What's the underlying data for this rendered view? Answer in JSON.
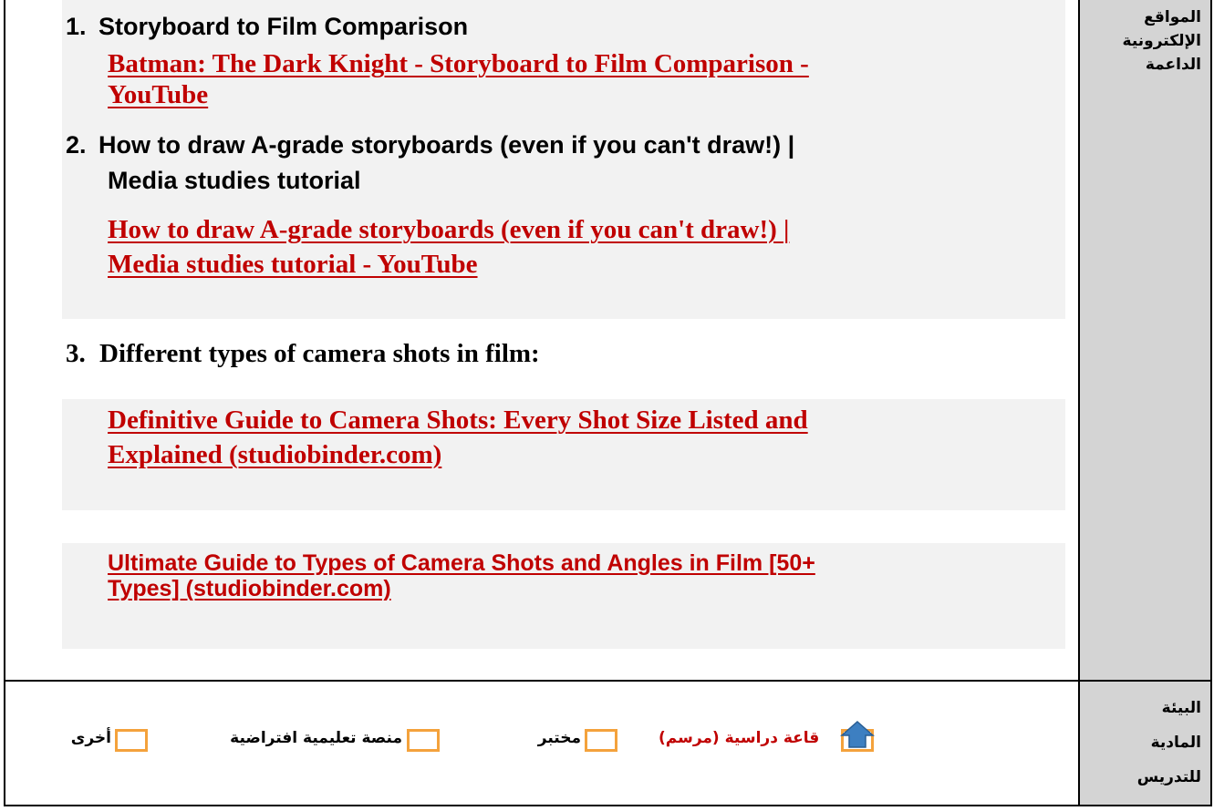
{
  "websites_section": {
    "label_line1": "المواقع",
    "label_line2": "الإلكترونية",
    "label_line3": "الداعمة",
    "items": [
      {
        "number": "1.",
        "title": "Storyboard to Film Comparison",
        "link_line1": "Batman: The Dark Knight - Storyboard to Film Comparison -",
        "link_line2": "YouTube"
      },
      {
        "number": "2.",
        "title_line1": "How to draw A-grade storyboards (even if you can't draw!) |",
        "title_line2": "Media studies tutorial",
        "link_line1": "How to draw A-grade storyboards (even if you can't draw!) |",
        "link_line2": "Media studies tutorial - YouTube"
      },
      {
        "number": "3.",
        "title": "Different types of camera shots in film:",
        "link1_line1": "Definitive Guide to Camera Shots: Every Shot Size Listed and",
        "link1_line2": "Explained (studiobinder.com)",
        "link2_line1": "Ultimate Guide to Types of Camera Shots and Angles in Film [50+",
        "link2_line2": "Types] (studiobinder.com)"
      }
    ]
  },
  "environment_section": {
    "label_line1": "البيئة",
    "label_line2": "المادية",
    "label_line3": "للتدريس",
    "options": [
      {
        "label": "قاعة دراسية (مرسم)",
        "checked": true,
        "color": "#c00000"
      },
      {
        "label": "مختبر",
        "checked": false,
        "color": "#000000"
      },
      {
        "label": "منصة تعليمية افتراضية",
        "checked": false,
        "color": "#000000"
      },
      {
        "label": "أخرى",
        "checked": false,
        "color": "#000000"
      }
    ]
  },
  "colors": {
    "link": "#c00000",
    "label_bg": "#d4d4d4",
    "checkbox_border": "#f4a23c",
    "check_arrow": "#3d7fc1"
  }
}
